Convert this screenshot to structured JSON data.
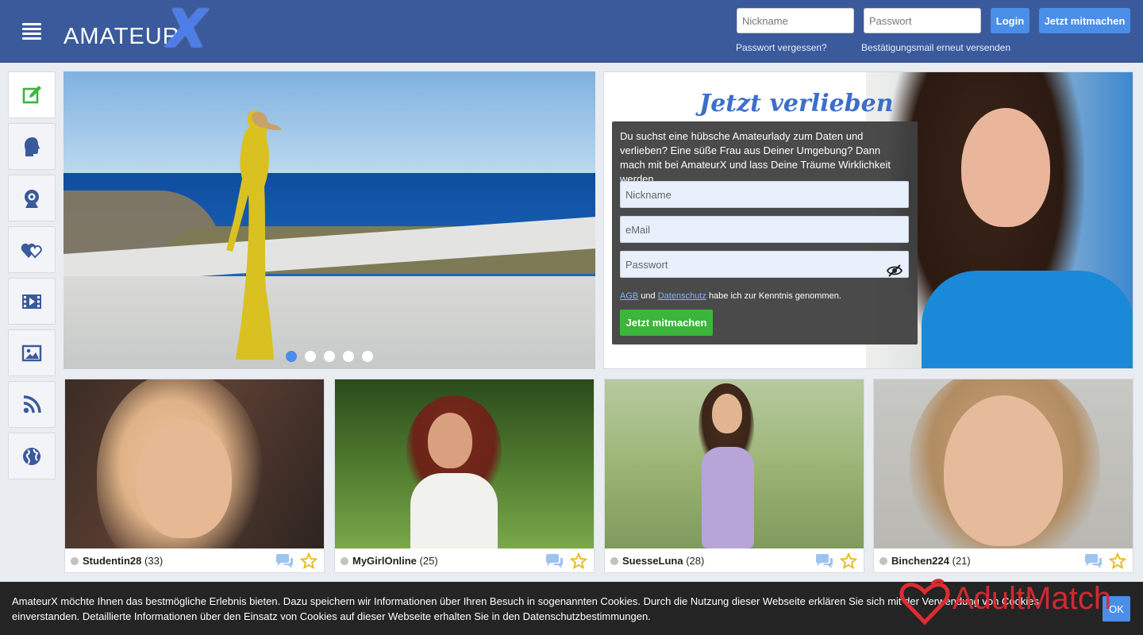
{
  "header": {
    "logo_text": "AMATEUR",
    "logo_x": "X",
    "nickname_placeholder": "Nickname",
    "password_placeholder": "Passwort",
    "login_label": "Login",
    "join_label": "Jetzt mitmachen",
    "forgot_password": "Passwort vergessen?",
    "resend_confirmation": "Bestätigungsmail erneut versenden"
  },
  "sidebar": {
    "items": [
      {
        "icon": "edit-icon"
      },
      {
        "icon": "profile-head-icon"
      },
      {
        "icon": "webcam-icon"
      },
      {
        "icon": "hearts-icon"
      },
      {
        "icon": "film-icon"
      },
      {
        "icon": "image-icon"
      },
      {
        "icon": "rss-icon"
      },
      {
        "icon": "globe-icon"
      }
    ]
  },
  "hero": {
    "slides": 5,
    "active_slide": 1
  },
  "register": {
    "title": "Jetzt verlieben",
    "intro": "Du suchst eine hübsche Amateurlady zum Daten und verlieben? Eine süße Frau aus Deiner Umgebung? Dann mach mit bei AmateurX und lass Deine Träume Wirklichkeit werden.",
    "nickname_placeholder": "Nickname",
    "email_placeholder": "eMail",
    "password_placeholder": "Passwort",
    "terms_agb": "AGB",
    "terms_und": "und",
    "terms_privacy": "Datenschutz",
    "terms_rest": "habe ich zur Kenntnis genommen.",
    "submit_label": "Jetzt mitmachen"
  },
  "profiles": [
    {
      "name": "Studentin28",
      "age": "(33)"
    },
    {
      "name": "MyGirlOnline",
      "age": "(25)"
    },
    {
      "name": "SuesseLuna",
      "age": "(28)"
    },
    {
      "name": "Binchen224",
      "age": "(21)"
    }
  ],
  "cookie": {
    "text": "AmateurX möchte Ihnen das bestmögliche Erlebnis bieten. Dazu speichern wir Informationen über Ihren Besuch in sogenannten Cookies. Durch die Nutzung dieser Webseite erklären Sie sich mit der Verwendung von Cookies einverstanden. Detaillierte Informationen über den Einsatz von Cookies auf dieser Webseite erhalten Sie in den Datenschutzbestimmungen.",
    "ok_label": "OK"
  },
  "watermark": "AdultMatch",
  "colors": {
    "header": "#3a5a9c",
    "accent": "#4a8ee8",
    "join_green": "#3bb53b",
    "watermark_red": "#e02a32"
  }
}
